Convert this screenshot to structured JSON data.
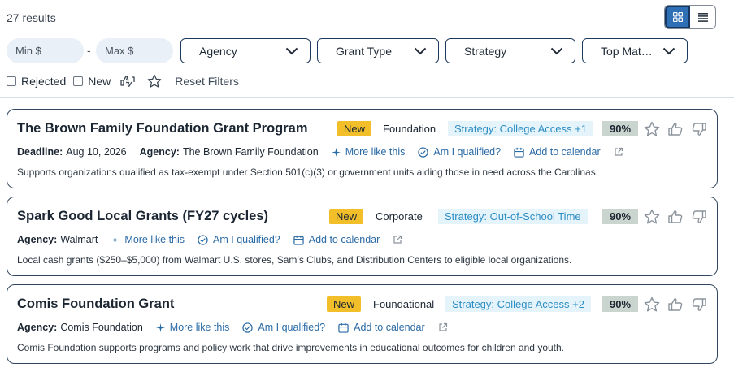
{
  "header": {
    "results_count": "27 results"
  },
  "filters": {
    "min_placeholder": "Min $",
    "max_placeholder": "Max $",
    "separator": "-",
    "dropdowns": [
      "Agency",
      "Grant Type",
      "Strategy",
      "Top Mat…"
    ]
  },
  "toggles": {
    "rejected": "Rejected",
    "new": "New",
    "reset": "Reset Filters"
  },
  "actions": {
    "more_like_this": "More like this",
    "am_i_qualified": "Am I qualified?",
    "add_to_calendar": "Add to calendar"
  },
  "cards": [
    {
      "title": "The Brown Family Foundation Grant Program",
      "badge": "New",
      "type": "Foundation",
      "strategy": "Strategy: College Access +1",
      "score": "90%",
      "deadline_label": "Deadline:",
      "deadline": "Aug 10, 2026",
      "agency_label": "Agency:",
      "agency": "The Brown Family Foundation",
      "description": "Supports organizations qualified as tax-exempt under Section 501(c)(3) or government units aiding those in need across the Carolinas."
    },
    {
      "title": "Spark Good Local Grants (FY27 cycles)",
      "badge": "New",
      "type": "Corporate",
      "strategy": "Strategy: Out-of-School Time",
      "score": "90%",
      "agency_label": "Agency:",
      "agency": "Walmart",
      "description": "Local cash grants ($250–$5,000) from Walmart U.S. stores, Sam’s Clubs, and Distribution Centers to eligible local organizations."
    },
    {
      "title": "Comis Foundation Grant",
      "badge": "New",
      "type": "Foundational",
      "strategy": "Strategy: College Access +2",
      "score": "90%",
      "agency_label": "Agency:",
      "agency": "Comis Foundation",
      "description": "Comis Foundation supports programs and policy work that drive improvements in educational outcomes for children and youth."
    }
  ],
  "icons": {
    "grid_view": "grid-icon",
    "list_view": "list-icon",
    "chevron": "chevron-down-icon",
    "thumbs_mixed": "thumbs-updown-icon",
    "star": "star-icon",
    "thumbs_up": "thumbs-up-icon",
    "thumbs_down": "thumbs-down-icon",
    "sparkle": "sparkle-icon",
    "check_circle": "check-circle-icon",
    "calendar": "calendar-icon",
    "external": "external-link-icon"
  },
  "colors": {
    "accent": "#2f6fb6",
    "new_badge": "#f2bf2a",
    "strategy_bg": "#e5f3fb",
    "strategy_text": "#2d8ec4",
    "score_bg": "#cbd5cf",
    "link": "#2a6aa5"
  }
}
